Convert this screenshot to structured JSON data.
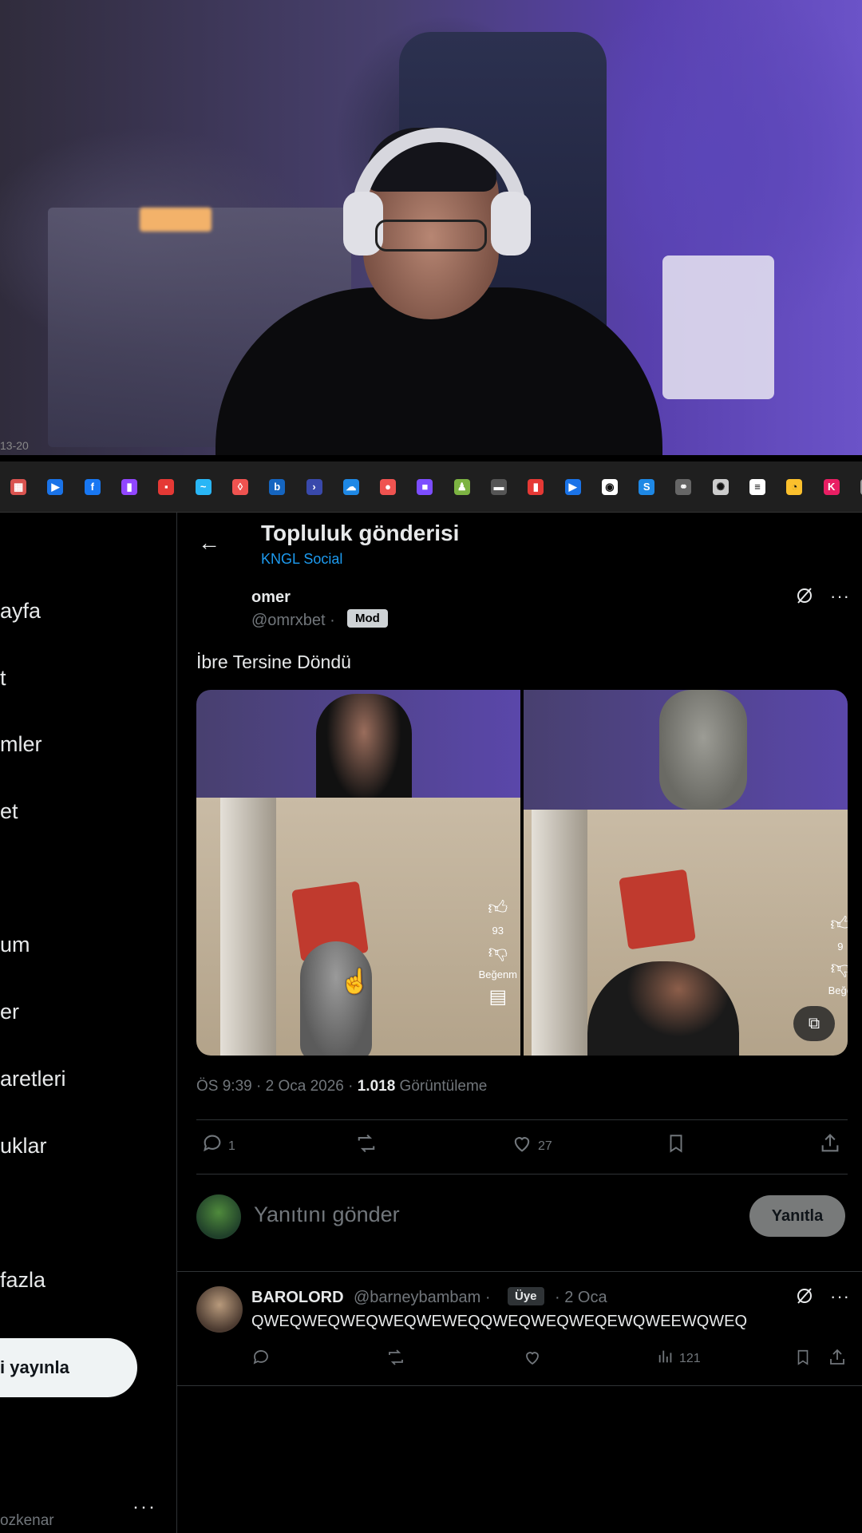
{
  "webcam": {
    "timer": "13-20"
  },
  "bookmarks": [
    {
      "icon": "calendar-icon",
      "color": "#d9534f",
      "glyph": "▦"
    },
    {
      "icon": "play-icon",
      "color": "#1a73e8",
      "glyph": "▶"
    },
    {
      "icon": "facebook-icon",
      "color": "#1877f2",
      "glyph": "f"
    },
    {
      "icon": "twitch-icon",
      "color": "#9146ff",
      "glyph": "▮"
    },
    {
      "icon": "red-tag-icon",
      "color": "#e53935",
      "glyph": "▪"
    },
    {
      "icon": "wave-icon",
      "color": "#29b6f6",
      "glyph": "~"
    },
    {
      "icon": "leaf-icon",
      "color": "#ef5350",
      "glyph": "◊"
    },
    {
      "icon": "b-icon",
      "color": "#1565c0",
      "glyph": "b"
    },
    {
      "icon": "arrow-icon",
      "color": "#3949ab",
      "glyph": "›"
    },
    {
      "icon": "cloud-icon",
      "color": "#1e88e5",
      "glyph": "☁"
    },
    {
      "icon": "brain-icon",
      "color": "#ef5350",
      "glyph": "●"
    },
    {
      "icon": "chat-icon",
      "color": "#7c4dff",
      "glyph": "■"
    },
    {
      "icon": "chess-icon",
      "color": "#7cb342",
      "glyph": "♟"
    },
    {
      "icon": "dash-icon",
      "color": "#555555",
      "glyph": "▬"
    },
    {
      "icon": "bars-icon",
      "color": "#e53935",
      "glyph": "▮"
    },
    {
      "icon": "play-blue-icon",
      "color": "#1a73e8",
      "glyph": "▶"
    },
    {
      "icon": "globe-icon",
      "color": "#ffffff",
      "glyph": "◉"
    },
    {
      "icon": "s-icon",
      "color": "#1e88e5",
      "glyph": "S"
    },
    {
      "icon": "link-icon",
      "color": "#666666",
      "glyph": "⚭"
    },
    {
      "icon": "openai-icon",
      "color": "#cccccc",
      "glyph": "✺"
    },
    {
      "icon": "database-icon",
      "color": "#ffffff",
      "glyph": "≡"
    },
    {
      "icon": "pacman-icon",
      "color": "#fbc02d",
      "glyph": "◔"
    },
    {
      "icon": "km-icon",
      "color": "#e91e63",
      "glyph": "K"
    },
    {
      "icon": "extra-icon",
      "color": "#999999",
      "glyph": "✓"
    }
  ],
  "sidebar": {
    "items": [
      {
        "label": "ayfa"
      },
      {
        "label": "t"
      },
      {
        "label": "mler"
      },
      {
        "label": "et"
      },
      {
        "label": "um"
      },
      {
        "label": "er"
      },
      {
        "label": "aretleri"
      },
      {
        "label": "uklar"
      },
      {
        "label": "fazla"
      }
    ],
    "publish_label": "i yayınla",
    "user_handle": "ozkenar",
    "more_glyph": "···"
  },
  "header": {
    "back_glyph": "←",
    "title": "Topluluk gönderisi",
    "subtitle": "KNGL Social"
  },
  "post": {
    "author_name": "omer",
    "author_handle": "@omrxbet ·",
    "badge": "Mod",
    "text": "İbre Tersine Döndü",
    "media_counts": [
      "93",
      "9"
    ],
    "media_label": "Beğenm",
    "media_label_2": "Beğe",
    "meta_time": "ÖS 9:39 · 2 Oca 2026 · ",
    "meta_views": "1.018",
    "meta_views_label": " Görüntüleme",
    "actions": {
      "reply_count": "1",
      "like_count": "27"
    }
  },
  "reply_box": {
    "placeholder": "Yanıtını gönder",
    "button_label": "Yanıtla"
  },
  "comment": {
    "name": "BAROLORD",
    "handle": "@barneybambam ·",
    "badge": "Üye",
    "date": "· 2 Oca",
    "text": "QWEQWEQWEQWEQWEWEQQWEQWEQWEQEWQWEEWQWEQ",
    "views": "121"
  },
  "colors": {
    "accent": "#1d9bf0",
    "background": "#000000",
    "muted": "#71767b"
  }
}
